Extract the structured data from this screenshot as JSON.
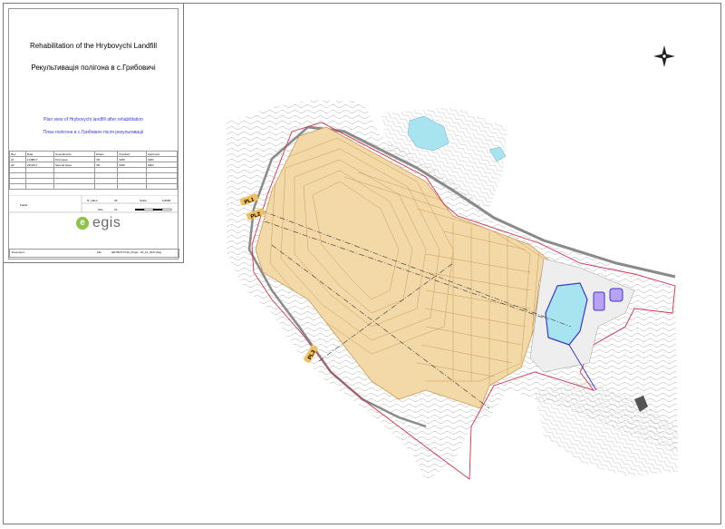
{
  "titleblock": {
    "project_en": "Rehabilitation of the Hrybovychi Landfill",
    "project_ua": "Рекультивація полігона в с.Грибовичі",
    "sheet_en": "Plan view of Hrybovychi landfill after rehabilitation",
    "sheet_ua": "План полігона в с.Грибовичі після рекультивації",
    "revisions_header": [
      "Rev",
      "Date",
      "Amendments",
      "Drawn",
      "Checked",
      "Approved"
    ],
    "revisions": [
      [
        "A1",
        "11/08/17",
        "First issue",
        "VR",
        "GRD",
        "GRD"
      ],
      [
        "A2",
        "22/11/17",
        "Second issue",
        "VR",
        "GRD",
        "GRD"
      ]
    ],
    "folder_label": "Folder :",
    "nplace_label": "N° place :",
    "nplace_value": "03",
    "scale_label": "Scale :",
    "scale_value": "1/2000",
    "size_label": "Size :",
    "size_value": "A1",
    "document_label": "Document :",
    "file_label": "File :",
    "file_value": "HRYBOVYCHI_Projet - 20_12_2017.dwg",
    "logo_text": "egis"
  },
  "map": {
    "profile_labels": [
      "PL1",
      "PL2",
      "PL3"
    ],
    "north_arrow": "north-arrow",
    "colors": {
      "landfill_fill": "#f3d9a8",
      "contour": "#c89a55",
      "boundary": "#d2304f",
      "road": "#8a8a8a",
      "pond": "#a8e3f0",
      "basin_outline": "#3a3ac8",
      "small_basin": "#9b7cf0",
      "terrain_contour": "#9a9a9a",
      "label_fill": "#f0c060"
    }
  }
}
